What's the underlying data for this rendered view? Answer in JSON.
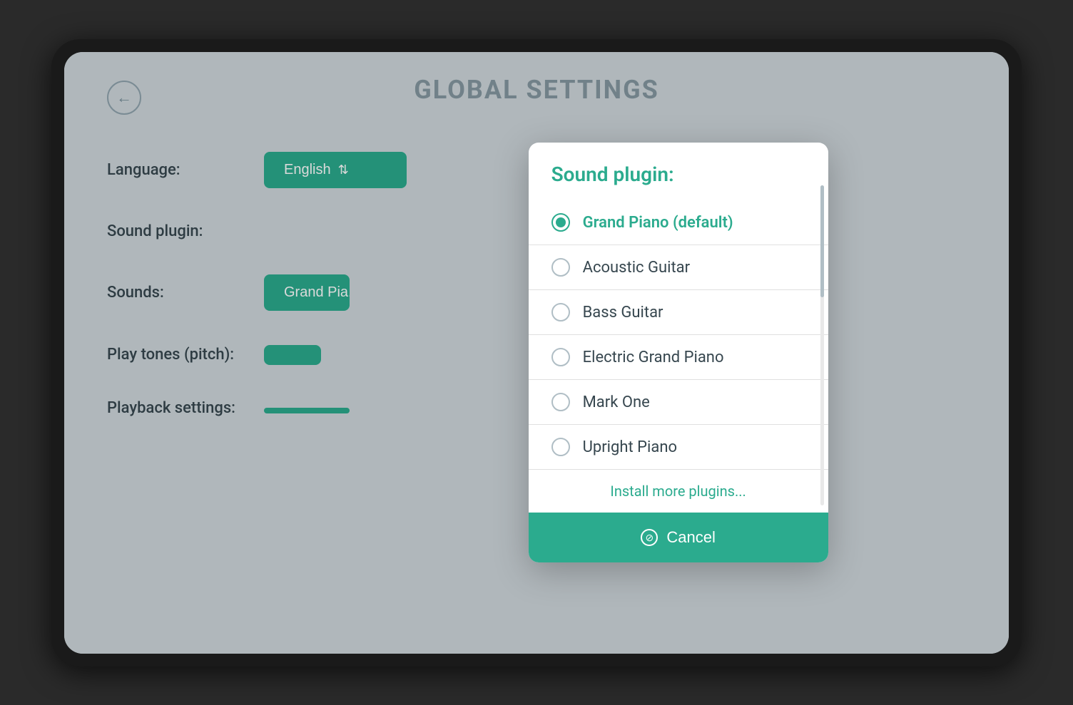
{
  "tablet": {
    "page_title": "GLOBAL SETTINGS"
  },
  "settings": {
    "back_label": "←",
    "rows": [
      {
        "label": "Language:",
        "btn_text": "English",
        "has_icon": true
      },
      {
        "label": "Sound plugin:",
        "btn_text": null
      },
      {
        "label": "Sounds:",
        "btn_text": "Grand Pia..."
      },
      {
        "label": "Play tones (pitch):",
        "btn_text": ""
      },
      {
        "label": "Playback settings:",
        "btn_text": ""
      }
    ]
  },
  "dialog": {
    "title": "Sound plugin:",
    "options": [
      {
        "id": "grand-piano",
        "label": "Grand Piano (default)",
        "selected": true
      },
      {
        "id": "acoustic-guitar",
        "label": "Acoustic Guitar",
        "selected": false
      },
      {
        "id": "bass-guitar",
        "label": "Bass Guitar",
        "selected": false
      },
      {
        "id": "electric-grand-piano",
        "label": "Electric Grand Piano",
        "selected": false
      },
      {
        "id": "mark-one",
        "label": "Mark One",
        "selected": false
      },
      {
        "id": "upright-piano",
        "label": "Upright Piano",
        "selected": false
      }
    ],
    "install_more_label": "Install more plugins...",
    "cancel_label": "Cancel"
  },
  "colors": {
    "teal": "#2bab8e",
    "text_dark": "#37474f",
    "border": "#e0e0e0"
  }
}
